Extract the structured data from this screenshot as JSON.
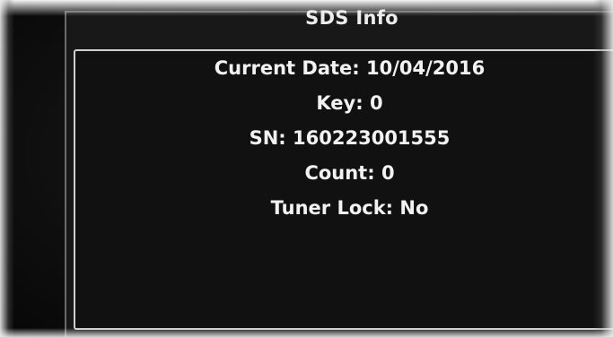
{
  "dialog": {
    "title": "SDS Info",
    "fields": [
      {
        "label": "Current Date:",
        "value": "10/04/2016"
      },
      {
        "label": "Key:",
        "value": "0"
      },
      {
        "label": "SN:",
        "value": "160223001555"
      },
      {
        "label": "Count:",
        "value": "0"
      },
      {
        "label": "Tuner Lock:",
        "value": "No"
      }
    ]
  }
}
